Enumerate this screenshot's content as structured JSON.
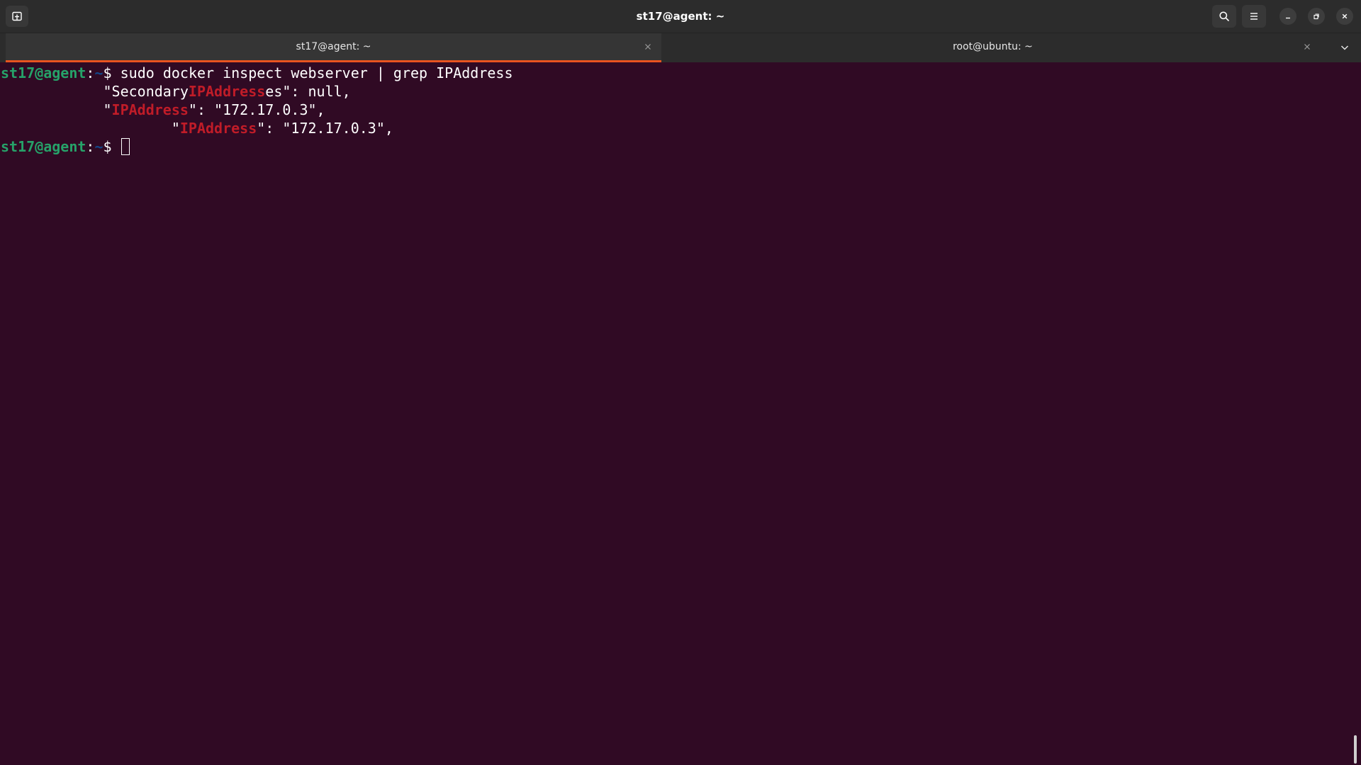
{
  "window": {
    "title": "st17@agent: ~"
  },
  "tabs": [
    {
      "label": "st17@agent: ~",
      "active": true
    },
    {
      "label": "root@ubuntu: ~",
      "active": false
    }
  ],
  "terminal": {
    "prompt_user": "st17@agent",
    "prompt_sep": ":",
    "prompt_path": "~",
    "prompt_symbol": "$ ",
    "command": "sudo docker inspect webserver | grep IPAddress",
    "output": [
      {
        "before": "            \"Secondary",
        "match": "IPAddress",
        "after": "es\": null,"
      },
      {
        "before": "            \"",
        "match": "IPAddress",
        "after": "\": \"172.17.0.3\","
      },
      {
        "before": "                    \"",
        "match": "IPAddress",
        "after": "\": \"172.17.0.3\","
      }
    ]
  },
  "icons": {
    "new_tab": "new-tab-icon",
    "search": "search-icon",
    "menu": "hamburger-menu-icon",
    "minimize": "minimize-icon",
    "maximize": "restore-icon",
    "close": "close-icon",
    "tab_close": "close-icon",
    "tab_dropdown": "chevron-down-icon"
  },
  "colors": {
    "terminal_bg": "#300a24",
    "headerbar_bg": "#2c2c2c",
    "active_tab_accent": "#e95420",
    "prompt_user": "#26a269",
    "prompt_path": "#12488b",
    "grep_match": "#c01c28"
  }
}
